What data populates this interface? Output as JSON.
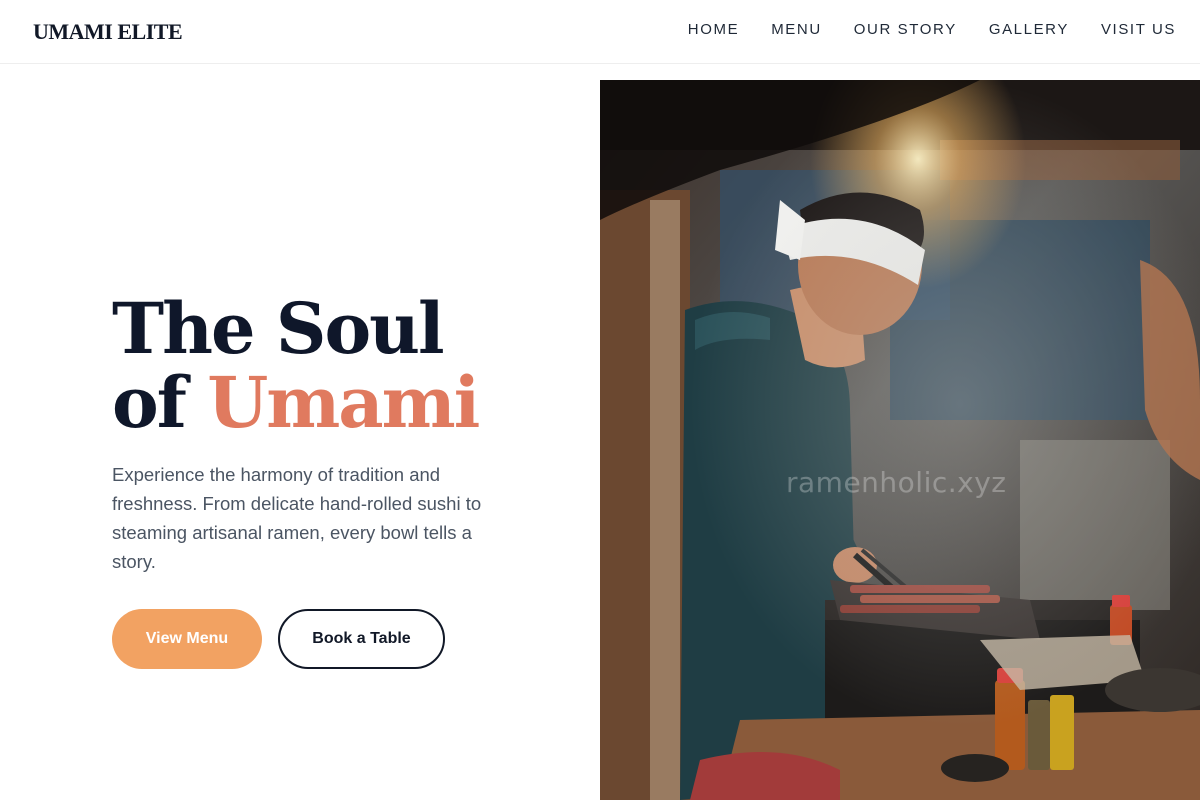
{
  "brand": "UMAMI ELITE",
  "nav": [
    "HOME",
    "MENU",
    "OUR STORY",
    "GALLERY",
    "VISIT US"
  ],
  "hero": {
    "title_line1": "The Soul",
    "title_of": "of",
    "title_accent": "Umami",
    "description": "Experience the harmony of tradition and freshness. From delicate hand-rolled sushi to steaming artisanal ramen, every bowl tells a story.",
    "primary_button": "View Menu",
    "secondary_button": "Book a Table"
  },
  "image": {
    "watermark": "ramenholic.xyz"
  },
  "colors": {
    "accent": "#e07a5f",
    "primary_button": "#f2a262",
    "heading": "#0f172a",
    "body_text": "#4b5563"
  }
}
